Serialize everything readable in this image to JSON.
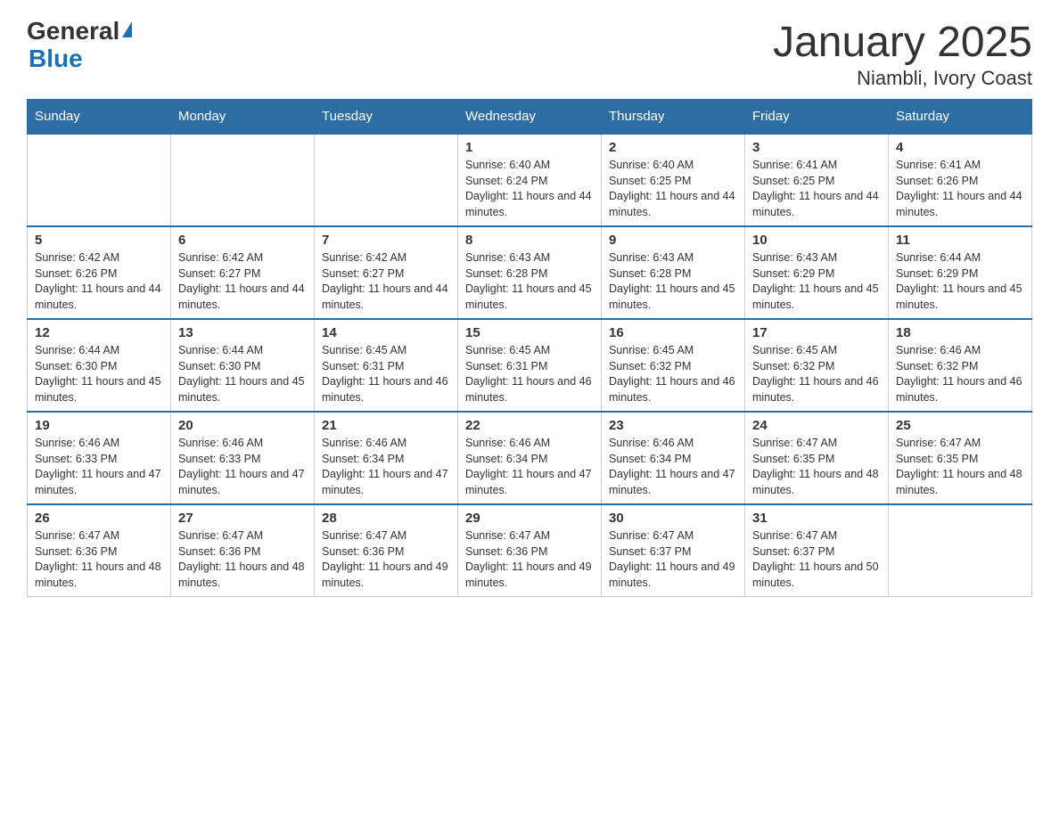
{
  "logo": {
    "general": "General",
    "blue": "Blue"
  },
  "title": "January 2025",
  "subtitle": "Niambli, Ivory Coast",
  "weekdays": [
    "Sunday",
    "Monday",
    "Tuesday",
    "Wednesday",
    "Thursday",
    "Friday",
    "Saturday"
  ],
  "weeks": [
    [
      {
        "day": "",
        "sunrise": "",
        "sunset": "",
        "daylight": ""
      },
      {
        "day": "",
        "sunrise": "",
        "sunset": "",
        "daylight": ""
      },
      {
        "day": "",
        "sunrise": "",
        "sunset": "",
        "daylight": ""
      },
      {
        "day": "1",
        "sunrise": "Sunrise: 6:40 AM",
        "sunset": "Sunset: 6:24 PM",
        "daylight": "Daylight: 11 hours and 44 minutes."
      },
      {
        "day": "2",
        "sunrise": "Sunrise: 6:40 AM",
        "sunset": "Sunset: 6:25 PM",
        "daylight": "Daylight: 11 hours and 44 minutes."
      },
      {
        "day": "3",
        "sunrise": "Sunrise: 6:41 AM",
        "sunset": "Sunset: 6:25 PM",
        "daylight": "Daylight: 11 hours and 44 minutes."
      },
      {
        "day": "4",
        "sunrise": "Sunrise: 6:41 AM",
        "sunset": "Sunset: 6:26 PM",
        "daylight": "Daylight: 11 hours and 44 minutes."
      }
    ],
    [
      {
        "day": "5",
        "sunrise": "Sunrise: 6:42 AM",
        "sunset": "Sunset: 6:26 PM",
        "daylight": "Daylight: 11 hours and 44 minutes."
      },
      {
        "day": "6",
        "sunrise": "Sunrise: 6:42 AM",
        "sunset": "Sunset: 6:27 PM",
        "daylight": "Daylight: 11 hours and 44 minutes."
      },
      {
        "day": "7",
        "sunrise": "Sunrise: 6:42 AM",
        "sunset": "Sunset: 6:27 PM",
        "daylight": "Daylight: 11 hours and 44 minutes."
      },
      {
        "day": "8",
        "sunrise": "Sunrise: 6:43 AM",
        "sunset": "Sunset: 6:28 PM",
        "daylight": "Daylight: 11 hours and 45 minutes."
      },
      {
        "day": "9",
        "sunrise": "Sunrise: 6:43 AM",
        "sunset": "Sunset: 6:28 PM",
        "daylight": "Daylight: 11 hours and 45 minutes."
      },
      {
        "day": "10",
        "sunrise": "Sunrise: 6:43 AM",
        "sunset": "Sunset: 6:29 PM",
        "daylight": "Daylight: 11 hours and 45 minutes."
      },
      {
        "day": "11",
        "sunrise": "Sunrise: 6:44 AM",
        "sunset": "Sunset: 6:29 PM",
        "daylight": "Daylight: 11 hours and 45 minutes."
      }
    ],
    [
      {
        "day": "12",
        "sunrise": "Sunrise: 6:44 AM",
        "sunset": "Sunset: 6:30 PM",
        "daylight": "Daylight: 11 hours and 45 minutes."
      },
      {
        "day": "13",
        "sunrise": "Sunrise: 6:44 AM",
        "sunset": "Sunset: 6:30 PM",
        "daylight": "Daylight: 11 hours and 45 minutes."
      },
      {
        "day": "14",
        "sunrise": "Sunrise: 6:45 AM",
        "sunset": "Sunset: 6:31 PM",
        "daylight": "Daylight: 11 hours and 46 minutes."
      },
      {
        "day": "15",
        "sunrise": "Sunrise: 6:45 AM",
        "sunset": "Sunset: 6:31 PM",
        "daylight": "Daylight: 11 hours and 46 minutes."
      },
      {
        "day": "16",
        "sunrise": "Sunrise: 6:45 AM",
        "sunset": "Sunset: 6:32 PM",
        "daylight": "Daylight: 11 hours and 46 minutes."
      },
      {
        "day": "17",
        "sunrise": "Sunrise: 6:45 AM",
        "sunset": "Sunset: 6:32 PM",
        "daylight": "Daylight: 11 hours and 46 minutes."
      },
      {
        "day": "18",
        "sunrise": "Sunrise: 6:46 AM",
        "sunset": "Sunset: 6:32 PM",
        "daylight": "Daylight: 11 hours and 46 minutes."
      }
    ],
    [
      {
        "day": "19",
        "sunrise": "Sunrise: 6:46 AM",
        "sunset": "Sunset: 6:33 PM",
        "daylight": "Daylight: 11 hours and 47 minutes."
      },
      {
        "day": "20",
        "sunrise": "Sunrise: 6:46 AM",
        "sunset": "Sunset: 6:33 PM",
        "daylight": "Daylight: 11 hours and 47 minutes."
      },
      {
        "day": "21",
        "sunrise": "Sunrise: 6:46 AM",
        "sunset": "Sunset: 6:34 PM",
        "daylight": "Daylight: 11 hours and 47 minutes."
      },
      {
        "day": "22",
        "sunrise": "Sunrise: 6:46 AM",
        "sunset": "Sunset: 6:34 PM",
        "daylight": "Daylight: 11 hours and 47 minutes."
      },
      {
        "day": "23",
        "sunrise": "Sunrise: 6:46 AM",
        "sunset": "Sunset: 6:34 PM",
        "daylight": "Daylight: 11 hours and 47 minutes."
      },
      {
        "day": "24",
        "sunrise": "Sunrise: 6:47 AM",
        "sunset": "Sunset: 6:35 PM",
        "daylight": "Daylight: 11 hours and 48 minutes."
      },
      {
        "day": "25",
        "sunrise": "Sunrise: 6:47 AM",
        "sunset": "Sunset: 6:35 PM",
        "daylight": "Daylight: 11 hours and 48 minutes."
      }
    ],
    [
      {
        "day": "26",
        "sunrise": "Sunrise: 6:47 AM",
        "sunset": "Sunset: 6:36 PM",
        "daylight": "Daylight: 11 hours and 48 minutes."
      },
      {
        "day": "27",
        "sunrise": "Sunrise: 6:47 AM",
        "sunset": "Sunset: 6:36 PM",
        "daylight": "Daylight: 11 hours and 48 minutes."
      },
      {
        "day": "28",
        "sunrise": "Sunrise: 6:47 AM",
        "sunset": "Sunset: 6:36 PM",
        "daylight": "Daylight: 11 hours and 49 minutes."
      },
      {
        "day": "29",
        "sunrise": "Sunrise: 6:47 AM",
        "sunset": "Sunset: 6:36 PM",
        "daylight": "Daylight: 11 hours and 49 minutes."
      },
      {
        "day": "30",
        "sunrise": "Sunrise: 6:47 AM",
        "sunset": "Sunset: 6:37 PM",
        "daylight": "Daylight: 11 hours and 49 minutes."
      },
      {
        "day": "31",
        "sunrise": "Sunrise: 6:47 AM",
        "sunset": "Sunset: 6:37 PM",
        "daylight": "Daylight: 11 hours and 50 minutes."
      },
      {
        "day": "",
        "sunrise": "",
        "sunset": "",
        "daylight": ""
      }
    ]
  ]
}
